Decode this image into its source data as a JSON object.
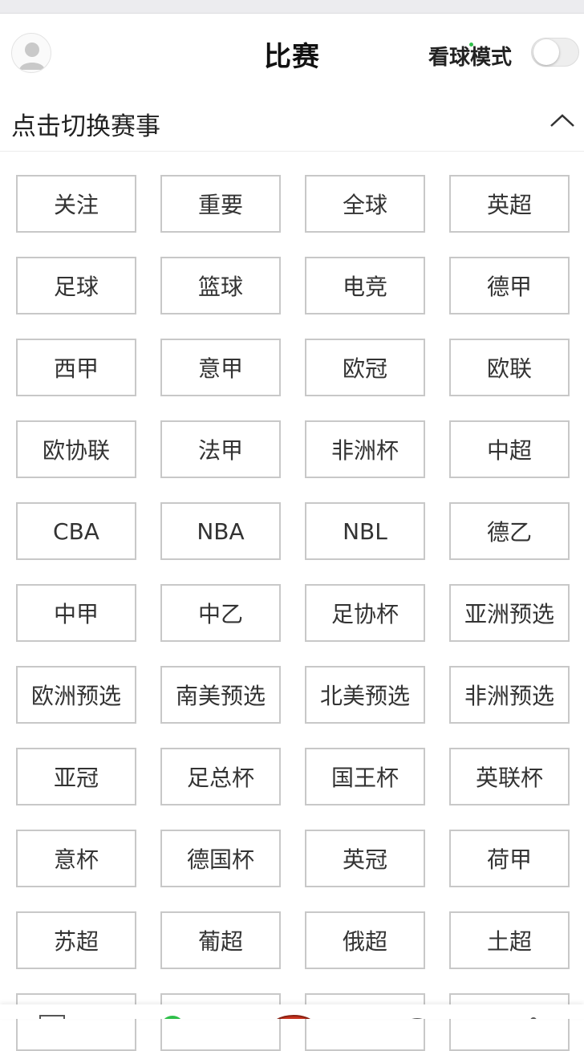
{
  "header": {
    "title": "比赛",
    "mode_label": "看球模式",
    "mode_enabled": false
  },
  "switch_section": {
    "label": "点击切换赛事"
  },
  "categories": [
    "关注",
    "重要",
    "全球",
    "英超",
    "足球",
    "篮球",
    "电竞",
    "德甲",
    "西甲",
    "意甲",
    "欧冠",
    "欧联",
    "欧协联",
    "法甲",
    "非洲杯",
    "中超",
    "CBA",
    "NBA",
    "NBL",
    "德乙",
    "中甲",
    "中乙",
    "足协杯",
    "亚洲预选",
    "欧洲预选",
    "南美预选",
    "北美预选",
    "非洲预选",
    "亚冠",
    "足总杯",
    "国王杯",
    "英联杯",
    "意杯",
    "德国杯",
    "英冠",
    "荷甲",
    "苏超",
    "葡超",
    "俄超",
    "土超",
    "",
    "",
    "",
    ""
  ],
  "colors": {
    "chip_border": "#c8c8c8",
    "text": "#333333",
    "accent_green": "#2fbf4a"
  }
}
